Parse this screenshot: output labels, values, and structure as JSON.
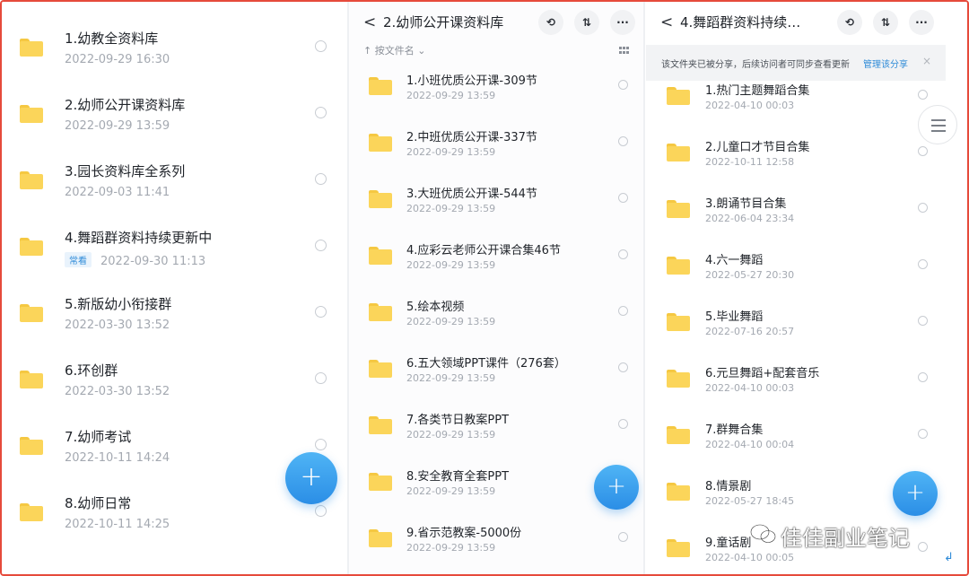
{
  "panel1": {
    "items": [
      {
        "name": "1.幼教全资料库",
        "date": "2022-09-29  16:30"
      },
      {
        "name": "2.幼师公开课资料库",
        "date": "2022-09-29  13:59"
      },
      {
        "name": "3.园长资料库全系列",
        "date": "2022-09-03  11:41"
      },
      {
        "name": "4.舞蹈群资料持续更新中",
        "date": "2022-09-30  11:13",
        "badge": "常看"
      },
      {
        "name": "5.新版幼小衔接群",
        "date": "2022-03-30  13:52"
      },
      {
        "name": "6.环创群",
        "date": "2022-03-30  13:52"
      },
      {
        "name": "7.幼师考试",
        "date": "2022-10-11  14:24"
      },
      {
        "name": "8.幼师日常",
        "date": "2022-10-11  14:25"
      }
    ]
  },
  "panel2": {
    "back": "<",
    "title": "2.幼师公开课资料库",
    "sort_label": "↑ 按文件名 ⌄",
    "items": [
      {
        "name": "1.小班优质公开课-309节",
        "date": "2022-09-29  13:59"
      },
      {
        "name": "2.中班优质公开课-337节",
        "date": "2022-09-29  13:59"
      },
      {
        "name": "3.大班优质公开课-544节",
        "date": "2022-09-29  13:59"
      },
      {
        "name": "4.应彩云老师公开课合集46节",
        "date": "2022-09-29  13:59"
      },
      {
        "name": "5.绘本视频",
        "date": "2022-09-29  13:59"
      },
      {
        "name": "6.五大领域PPT课件（276套）",
        "date": "2022-09-29  13:59"
      },
      {
        "name": "7.各类节日教案PPT",
        "date": "2022-09-29  13:59"
      },
      {
        "name": "8.安全教育全套PPT",
        "date": "2022-09-29  13:59"
      },
      {
        "name": "9.省示范教案-5000份",
        "date": "2022-09-29  13:59"
      }
    ]
  },
  "panel3": {
    "back": "<",
    "title": "4.舞蹈群资料持续…",
    "notice_text": "该文件夹已被分享，后续访问者可同步查看更新",
    "notice_link": "管理该分享",
    "notice_close": "×",
    "items": [
      {
        "name": "1.热门主题舞蹈合集",
        "date": "2022-04-10  00:03"
      },
      {
        "name": "2.儿童口才节目合集",
        "date": "2022-10-11  12:58"
      },
      {
        "name": "3.朗诵节目合集",
        "date": "2022-06-04  23:34"
      },
      {
        "name": "4.六一舞蹈",
        "date": "2022-05-27  20:30"
      },
      {
        "name": "5.毕业舞蹈",
        "date": "2022-07-16  20:57"
      },
      {
        "name": "6.元旦舞蹈+配套音乐",
        "date": "2022-04-10  00:03"
      },
      {
        "name": "7.群舞合集",
        "date": "2022-04-10  00:04"
      },
      {
        "name": "8.情景剧",
        "date": "2022-05-27  18:45"
      },
      {
        "name": "9.童话剧",
        "date": "2022-04-10  00:05"
      }
    ]
  },
  "fab_label": "+",
  "header_buttons": {
    "history": "⟲",
    "sort": "⇅",
    "more": "···"
  },
  "watermark": "佳佳副业笔记",
  "icons": {
    "folder": "folder-icon",
    "radio": "select-radio-icon",
    "menu": "hamburger-menu-icon",
    "wechat": "wechat-icon"
  },
  "colors": {
    "accent": "#2b8ee6",
    "folder": "#fbd55a",
    "border": "#e64a3b"
  }
}
